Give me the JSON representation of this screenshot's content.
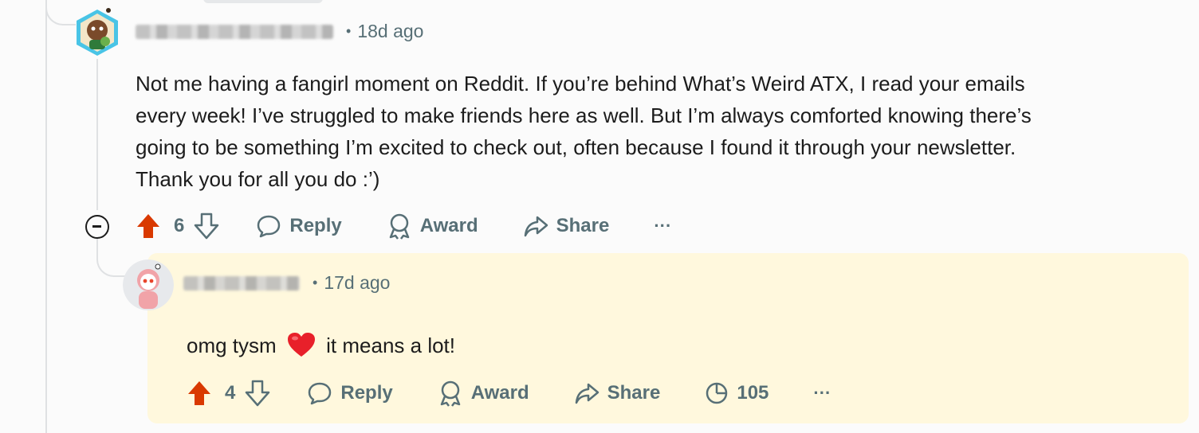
{
  "comment": {
    "author_blurred": true,
    "time": "18d ago",
    "text_lines": [
      "Not me having a fangirl moment on Reddit. If you’re behind What’s Weird ATX, I read your emails",
      "every week! I’ve struggled to make friends here as well. But I’m always comforted knowing there’s",
      "going to be something I’m excited to check out, often because I found it through your newsletter.",
      "Thank you for all you do :’)"
    ],
    "votes": "6",
    "reply_label": "Reply",
    "award_label": "Award",
    "share_label": "Share",
    "more_label": "···"
  },
  "reply": {
    "author_blurred": true,
    "time": "17d ago",
    "text_before": "omg tysm",
    "text_after": "it means a lot!",
    "votes": "4",
    "reply_label": "Reply",
    "award_label": "Award",
    "share_label": "Share",
    "views": "105",
    "more_label": "···"
  },
  "colors": {
    "upvote": "#d93900",
    "meta_text": "#576f76",
    "reply_highlight": "#fff8dd",
    "thread_line": "#dfe1e3"
  },
  "icons": [
    "upvote-icon",
    "downvote-icon",
    "reply-icon",
    "award-icon",
    "share-icon",
    "views-icon",
    "more-icon",
    "collapse-icon",
    "heart-emoji"
  ]
}
